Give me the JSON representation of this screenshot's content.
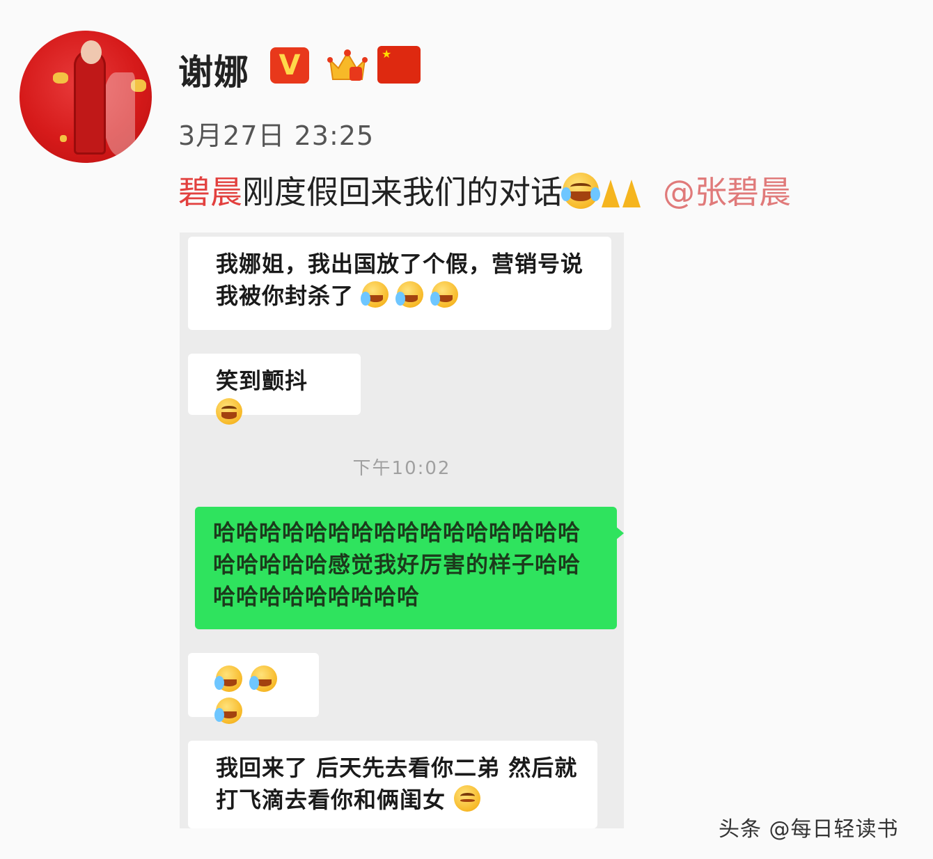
{
  "post": {
    "author": "谢娜",
    "verified_badge": "V",
    "timestamp": "3月27日 23:25",
    "caption": {
      "highlight": "碧晨",
      "text": "刚度假回来我们的对话",
      "mention": "@张碧晨"
    }
  },
  "chat": {
    "messages": [
      {
        "text": "我娜姐，我出国放了个假，营销号说我被你封杀了"
      },
      {
        "text": "笑到颤抖"
      },
      {
        "text": "哈哈哈哈哈哈哈哈哈哈哈哈哈哈哈哈哈哈哈哈哈感觉我好厉害的样子哈哈哈哈哈哈哈哈哈哈哈"
      },
      {
        "text": ""
      },
      {
        "text": "我回来了 后天先去看你二弟 然后就打飞滴去看你和俩闺女"
      }
    ],
    "time_separator": "下午10:02"
  },
  "watermark": "头条 @每日轻读书",
  "colors": {
    "sent_bubble": "#2fe35e",
    "received_bubble": "#ffffff",
    "caption_highlight": "#e2403e",
    "mention": "#e07a7a"
  }
}
